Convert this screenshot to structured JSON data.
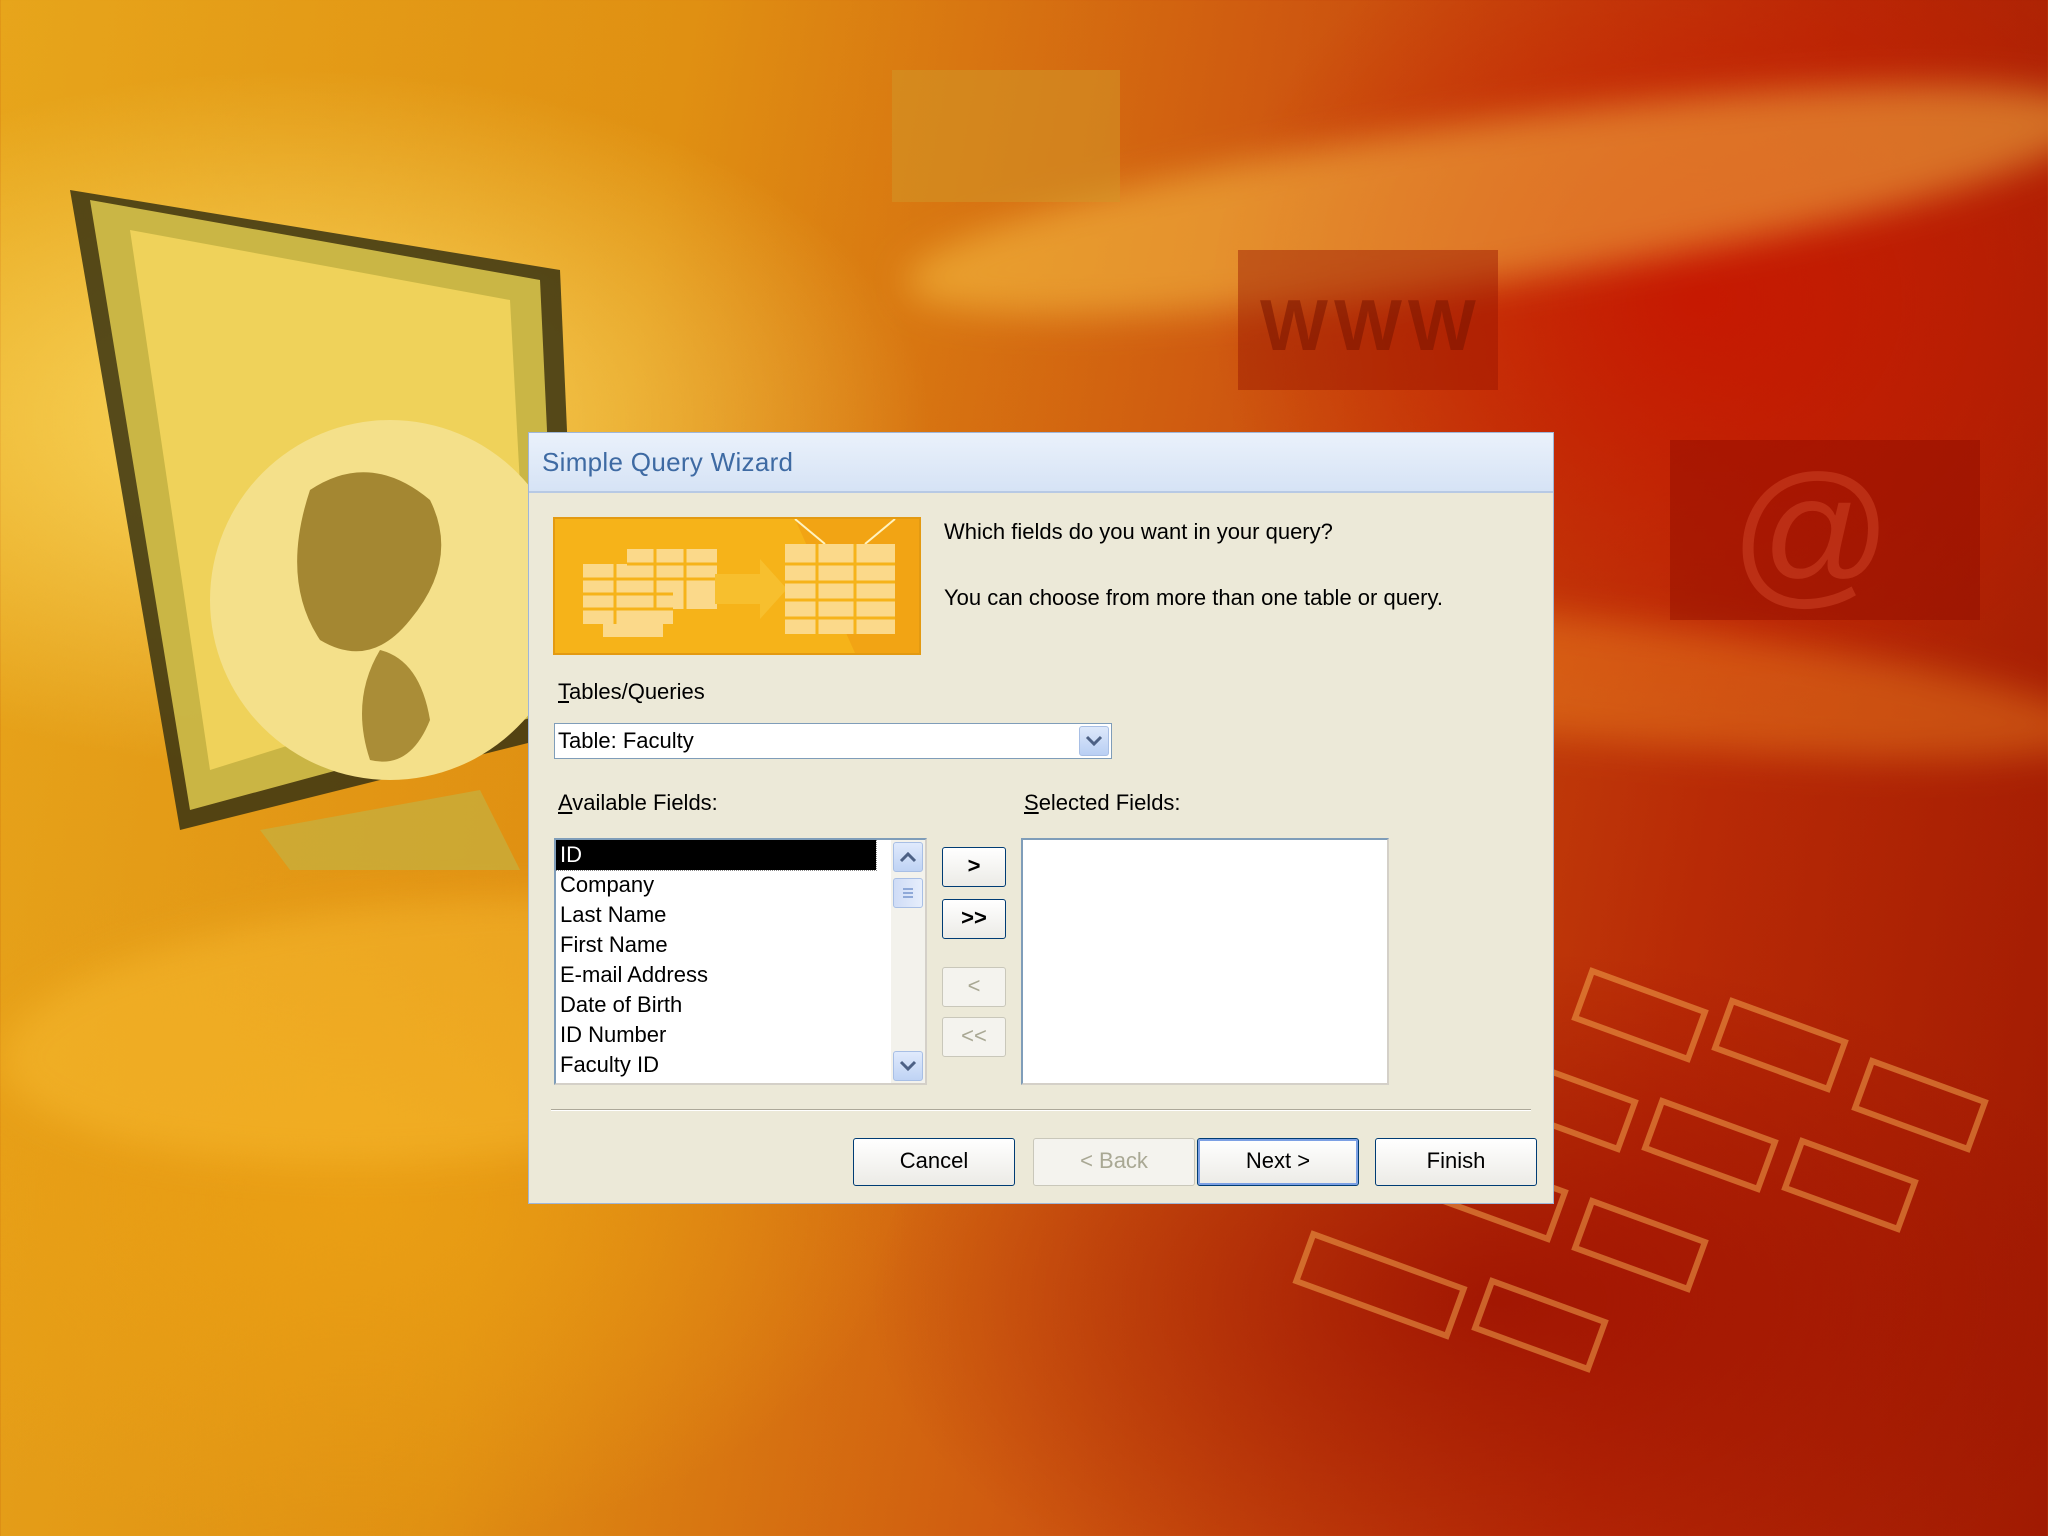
{
  "dialog": {
    "title": "Simple Query Wizard",
    "question": "Which fields do you want in your query?",
    "hint": "You can choose from more than one table or query.",
    "tables_label": "Tables/Queries",
    "tables_label_key": "T",
    "tables_label_rest": "ables/Queries",
    "table_selected": "Table: Faculty",
    "available_label_key": "A",
    "available_label_rest": "vailable Fields:",
    "selected_label_key": "S",
    "selected_label_rest": "elected Fields:",
    "available_fields": [
      "ID",
      "Company",
      "Last Name",
      "First Name",
      "E-mail Address",
      "Date of Birth",
      "ID Number",
      "Faculty ID"
    ],
    "selected_fields": [],
    "move_buttons": {
      "add_one": ">",
      "add_all": ">>",
      "remove_one": "<",
      "remove_all": "<<"
    },
    "buttons": {
      "cancel": "Cancel",
      "back": "< Back",
      "next": "Next >",
      "finish": "Finish"
    }
  },
  "background": {
    "text_www": "WWW",
    "text_at": "@"
  },
  "colors": {
    "dialog_bg": "#ece9d8",
    "title_text": "#3e6aa3",
    "selection_bg": "#000000",
    "accent_border": "#003c74"
  }
}
